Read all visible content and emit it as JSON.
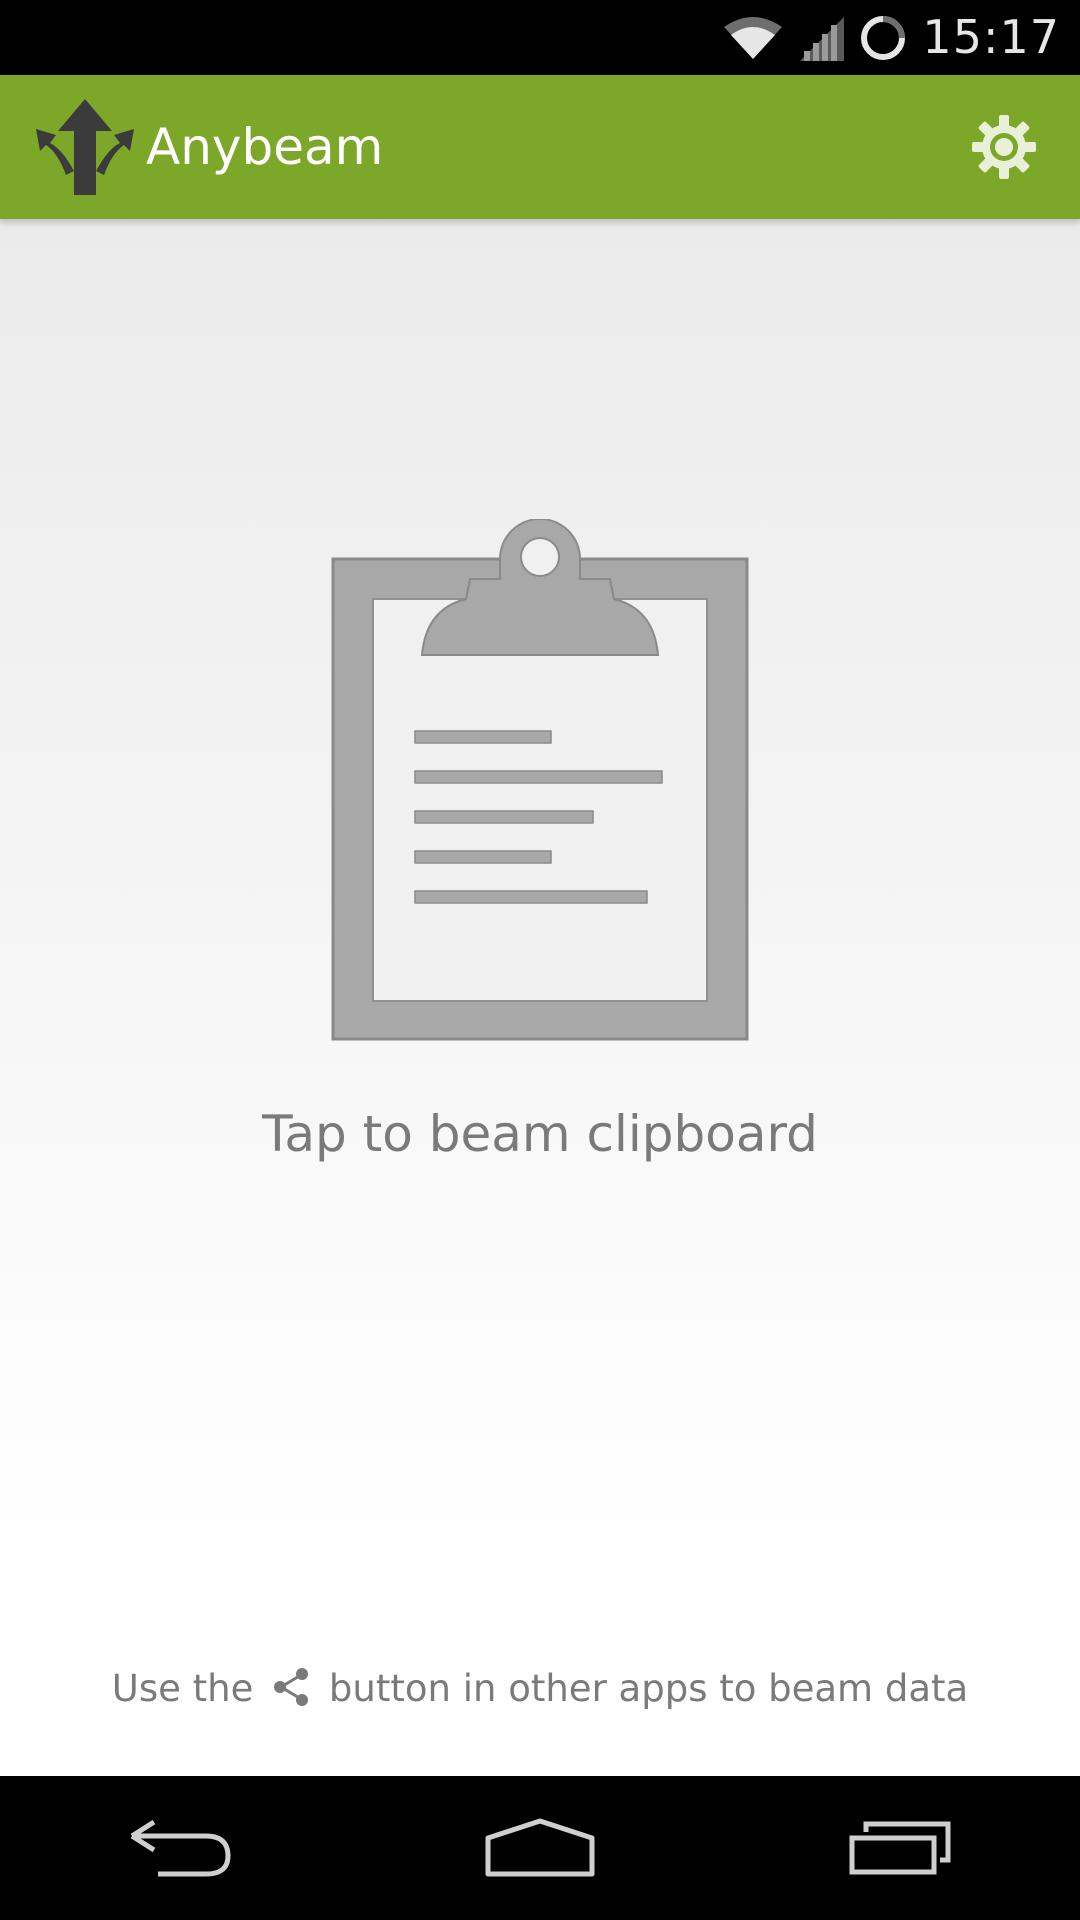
{
  "status_bar": {
    "time": "15:17",
    "icons": [
      "wifi-icon",
      "cell-signal-icon",
      "sync-progress-icon"
    ]
  },
  "action_bar": {
    "app_icon": "branching-arrows-logo",
    "title": "Anybeam",
    "settings_icon": "gear-icon"
  },
  "main": {
    "clipboard_icon": "clipboard-icon",
    "tap_label": "Tap to beam clipboard",
    "hint_before": "Use the",
    "hint_icon": "share-icon",
    "hint_after": "button in other apps to beam data"
  },
  "nav_bar": {
    "buttons": [
      "back-icon",
      "home-icon",
      "recents-icon"
    ]
  },
  "colors": {
    "accent": "#7da729",
    "icon_gray": "#a8a8a8",
    "text_gray": "#7a7a7a",
    "logo_dark": "#3b3b3b"
  }
}
